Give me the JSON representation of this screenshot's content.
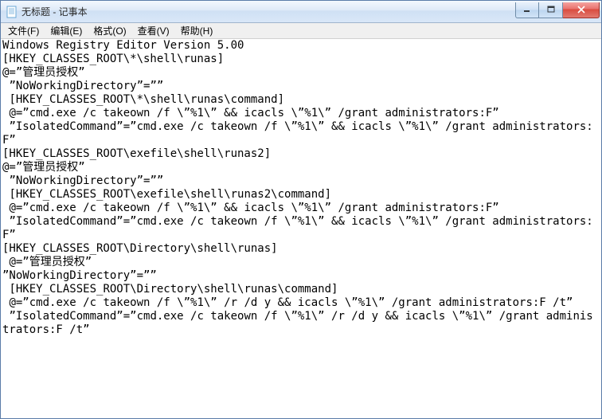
{
  "window": {
    "title": "无标题 - 记事本",
    "icon": "notepad-icon"
  },
  "controls": {
    "minimize": "minimize",
    "maximize": "maximize",
    "close": "close"
  },
  "menu": {
    "items": [
      {
        "label": "文件(F)"
      },
      {
        "label": "编辑(E)"
      },
      {
        "label": "格式(O)"
      },
      {
        "label": "查看(V)"
      },
      {
        "label": "帮助(H)"
      }
    ]
  },
  "document": {
    "text": "Windows Registry Editor Version 5.00\n[HKEY_CLASSES_ROOT\\*\\shell\\runas]\n@=”管理员授权”\n ”NoWorkingDirectory”=””\n [HKEY_CLASSES_ROOT\\*\\shell\\runas\\command]\n @=”cmd.exe /c takeown /f \\”%1\\” && icacls \\”%1\\” /grant administrators:F”\n ”IsolatedCommand”=”cmd.exe /c takeown /f \\”%1\\” && icacls \\”%1\\” /grant administrators:F”\n[HKEY_CLASSES_ROOT\\exefile\\shell\\runas2]\n@=”管理员授权”\n ”NoWorkingDirectory”=””\n [HKEY_CLASSES_ROOT\\exefile\\shell\\runas2\\command]\n @=”cmd.exe /c takeown /f \\”%1\\” && icacls \\”%1\\” /grant administrators:F”\n ”IsolatedCommand”=”cmd.exe /c takeown /f \\”%1\\” && icacls \\”%1\\” /grant administrators:F”\n[HKEY_CLASSES_ROOT\\Directory\\shell\\runas]\n @=”管理员授权”\n”NoWorkingDirectory”=””\n [HKEY_CLASSES_ROOT\\Directory\\shell\\runas\\command]\n @=”cmd.exe /c takeown /f \\”%1\\” /r /d y && icacls \\”%1\\” /grant administrators:F /t”\n ”IsolatedCommand”=”cmd.exe /c takeown /f \\”%1\\” /r /d y && icacls \\”%1\\” /grant administrators:F /t”"
  }
}
